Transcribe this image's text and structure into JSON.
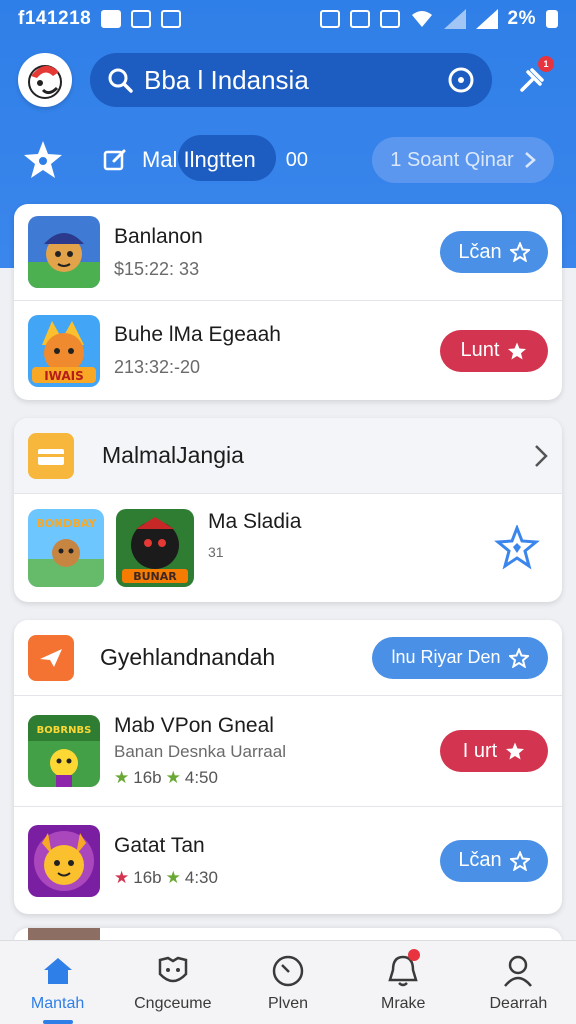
{
  "status_bar": {
    "time": "f141218",
    "battery": "2%"
  },
  "header": {
    "search_text": "Bba l Indansia",
    "badge": "1"
  },
  "tabs": {
    "edit_label": "Mal Ilngtten",
    "count": "00",
    "search_label": "1 Soant Qinar"
  },
  "featured": [
    {
      "title": "Banlanon",
      "subtitle": "$15:22: 33",
      "button": "Lčan",
      "button_color": "#4a90e6"
    },
    {
      "title": "Buhe lMa Egeaah",
      "subtitle": "213:32:-20",
      "button": "Lunt",
      "button_color": "#d3344f"
    }
  ],
  "section1": {
    "title": "MalmalJangia",
    "item_title": "Ma Sladia",
    "item_sub": "31",
    "thumb1_text": "BONDBAY",
    "thumb2_text": "BUNAR"
  },
  "section2": {
    "title": "Gyehlandnandah",
    "header_button": "lnu Riyar Den",
    "items": [
      {
        "title": "Mab VPon Gneal",
        "subtitle": "Banan Desnka Uarraal",
        "rating1": "16b",
        "rating2": "4:50",
        "button": "I urt",
        "button_color": "#d3344f"
      },
      {
        "title": "Gatat Tan",
        "subtitle": "",
        "rating1": "16b",
        "rating2": "4:30",
        "button": "Lčan",
        "button_color": "#4a90e6"
      }
    ]
  },
  "bottom_nav": [
    {
      "label": "Mantah",
      "icon": "home-icon"
    },
    {
      "label": "Cngceume",
      "icon": "face-icon"
    },
    {
      "label": "Plven",
      "icon": "clock-icon"
    },
    {
      "label": "Mrake",
      "icon": "bell-icon"
    },
    {
      "label": "Dearrah",
      "icon": "user-icon"
    }
  ]
}
